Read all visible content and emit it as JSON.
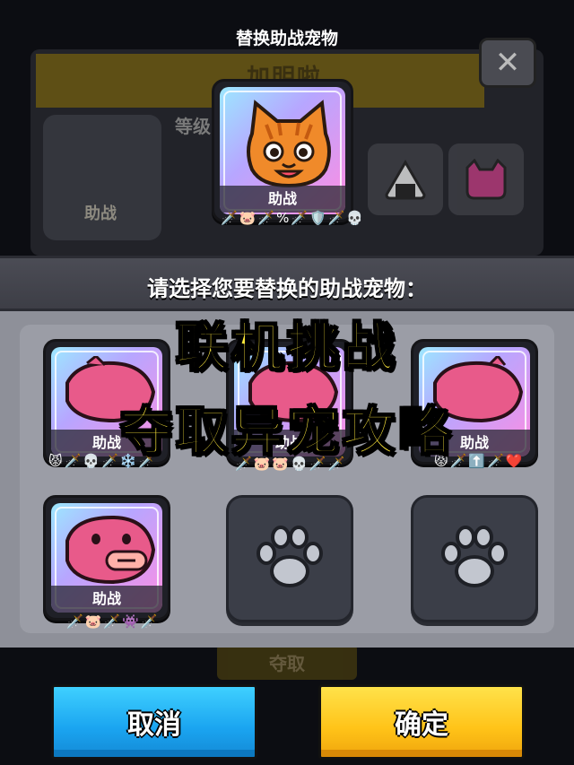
{
  "dialog": {
    "title": "替换助战宠物"
  },
  "background": {
    "banner_text": "加明啦",
    "close_icon": "close-icon",
    "level_label": "等级",
    "card_label": "助战",
    "bottom_button": "夺取"
  },
  "current_pet": {
    "name": "cat-pet",
    "tag": "助战",
    "badges": [
      "sword-icon",
      "pet-face-icon",
      "sword-icon",
      "percent-icon",
      "sword-icon",
      "shield-icon",
      "sword-icon",
      "skull-icon"
    ]
  },
  "selection": {
    "header": "请选择您要替换的助战宠物：",
    "pets": [
      {
        "tag": "助战",
        "badges": [
          "cat-face-icon",
          "sword-icon",
          "skull-icon",
          "sword-icon",
          "snowflake-icon",
          "sword-icon"
        ]
      },
      {
        "tag": "助战",
        "badges": [
          "sword-icon",
          "pet-face-icon",
          "pet-face-icon",
          "skull-icon",
          "sword-icon",
          "sword-icon"
        ]
      },
      {
        "tag": "助战",
        "badges": [
          "cat-face-icon",
          "sword-icon",
          "up-arrow-icon",
          "sword-icon",
          "heart-icon"
        ]
      },
      {
        "tag": "助战",
        "badges": [
          "sword-icon",
          "pet-face-icon",
          "sword-icon",
          "pet-face-icon",
          "sword-icon"
        ]
      }
    ],
    "empty_slots": [
      "paw-icon",
      "paw-icon"
    ]
  },
  "overlay": {
    "line1": "联机挑战",
    "line2": "夺取异宠攻略"
  },
  "buttons": {
    "cancel": "取消",
    "confirm": "确定"
  },
  "colors": {
    "cancel": "#1aa4f0",
    "confirm": "#ffc318",
    "overlay_text": "#ffe93b"
  }
}
